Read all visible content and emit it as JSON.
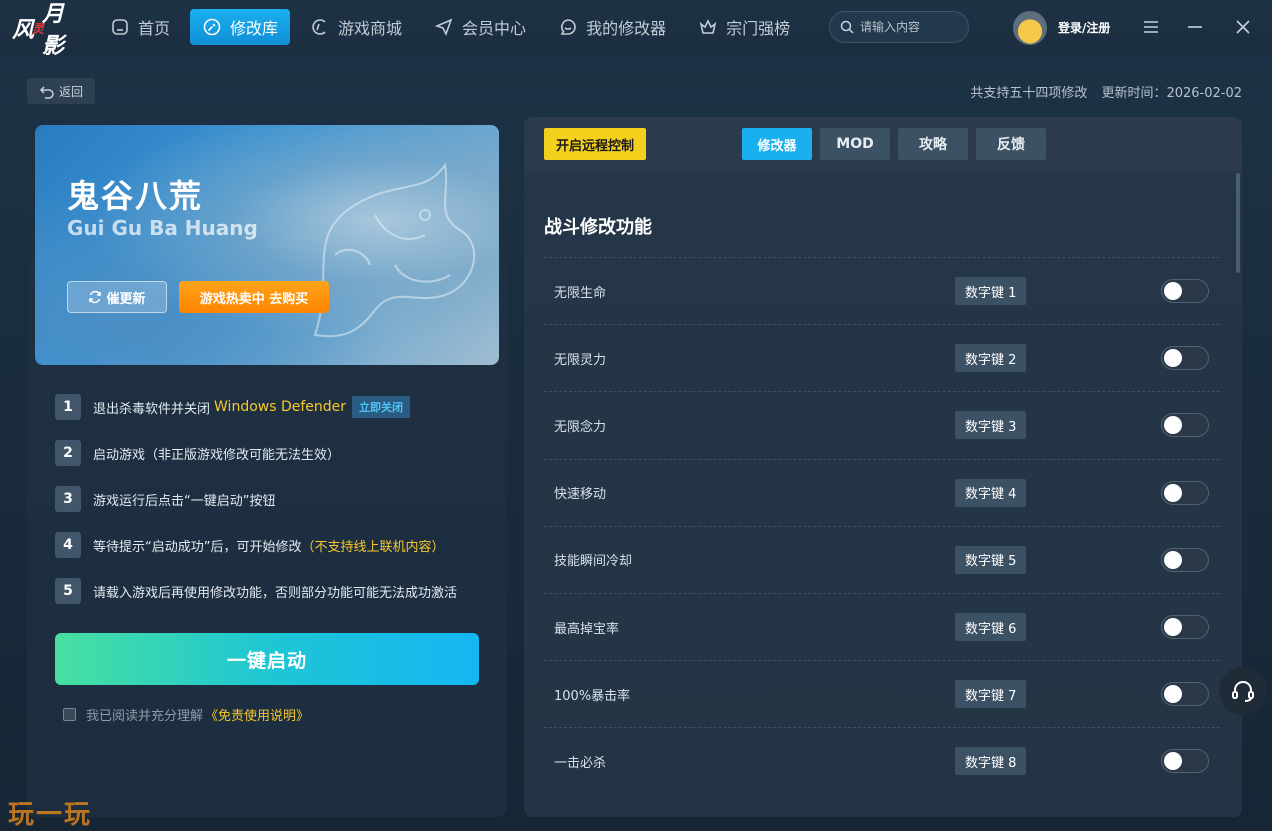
{
  "app": {
    "logo_text": "风",
    "logo_mark": "灵月影"
  },
  "nav": {
    "items": [
      {
        "label": "首页",
        "icon": "home-icon"
      },
      {
        "label": "修改库",
        "icon": "wrench-icon",
        "active": true
      },
      {
        "label": "游戏商城",
        "icon": "store-icon"
      },
      {
        "label": "会员中心",
        "icon": "send-icon"
      },
      {
        "label": "我的修改器",
        "icon": "chat-icon"
      },
      {
        "label": "宗门强榜",
        "icon": "crown-icon"
      }
    ]
  },
  "search": {
    "placeholder": "请输入内容"
  },
  "user": {
    "login_label": "登录/注册"
  },
  "subheader": {
    "back_label": "返回",
    "support_count": "共支持五十四项修改",
    "update_time": "更新时间：2026-02-02"
  },
  "game": {
    "title": "鬼谷八荒",
    "subtitle": "Gui Gu Ba Huang",
    "update_button": "催更新",
    "buy_button": "游戏热卖中 去购买"
  },
  "steps": [
    {
      "num": "1",
      "text": "退出杀毒软件并关闭",
      "highlight": "Windows Defender",
      "tag": "立即关闭"
    },
    {
      "num": "2",
      "text": "启动游戏（非正版游戏修改可能无法生效）"
    },
    {
      "num": "3",
      "text": "游戏运行后点击“一键启动”按钮"
    },
    {
      "num": "4",
      "text": "等待提示“启动成功”后，可开始修改",
      "highlight": "（不支持线上联机内容）"
    },
    {
      "num": "5",
      "text": "请载入游戏后再使用修改功能，否则部分功能可能无法成功激活"
    }
  ],
  "start_button": "一键启动",
  "agreement": {
    "text": "我已阅读并充分理解",
    "link": "《免责使用说明》"
  },
  "right": {
    "remote_button": "开启远程控制",
    "tabs": [
      "修改器",
      "MOD",
      "攻略",
      "反馈"
    ],
    "section_title": "战斗修改功能",
    "cheats": [
      {
        "name": "无限生命",
        "key": "数字键 1",
        "on": false
      },
      {
        "name": "无限灵力",
        "key": "数字键 2",
        "on": false
      },
      {
        "name": "无限念力",
        "key": "数字键 3",
        "on": false
      },
      {
        "name": "快速移动",
        "key": "数字键 4",
        "on": false
      },
      {
        "name": "技能瞬间冷却",
        "key": "数字键 5",
        "on": false
      },
      {
        "name": "最高掉宝率",
        "key": "数字键 6",
        "on": false
      },
      {
        "name": "100%暴击率",
        "key": "数字键 7",
        "on": false
      },
      {
        "name": "一击必杀",
        "key": "数字键 8",
        "on": false
      }
    ]
  },
  "watermark": "玩一玩",
  "colors": {
    "accent": "#1ab0ef",
    "warning": "#f7c82e",
    "buy": "#ff8500",
    "remote": "#f3d01b"
  }
}
